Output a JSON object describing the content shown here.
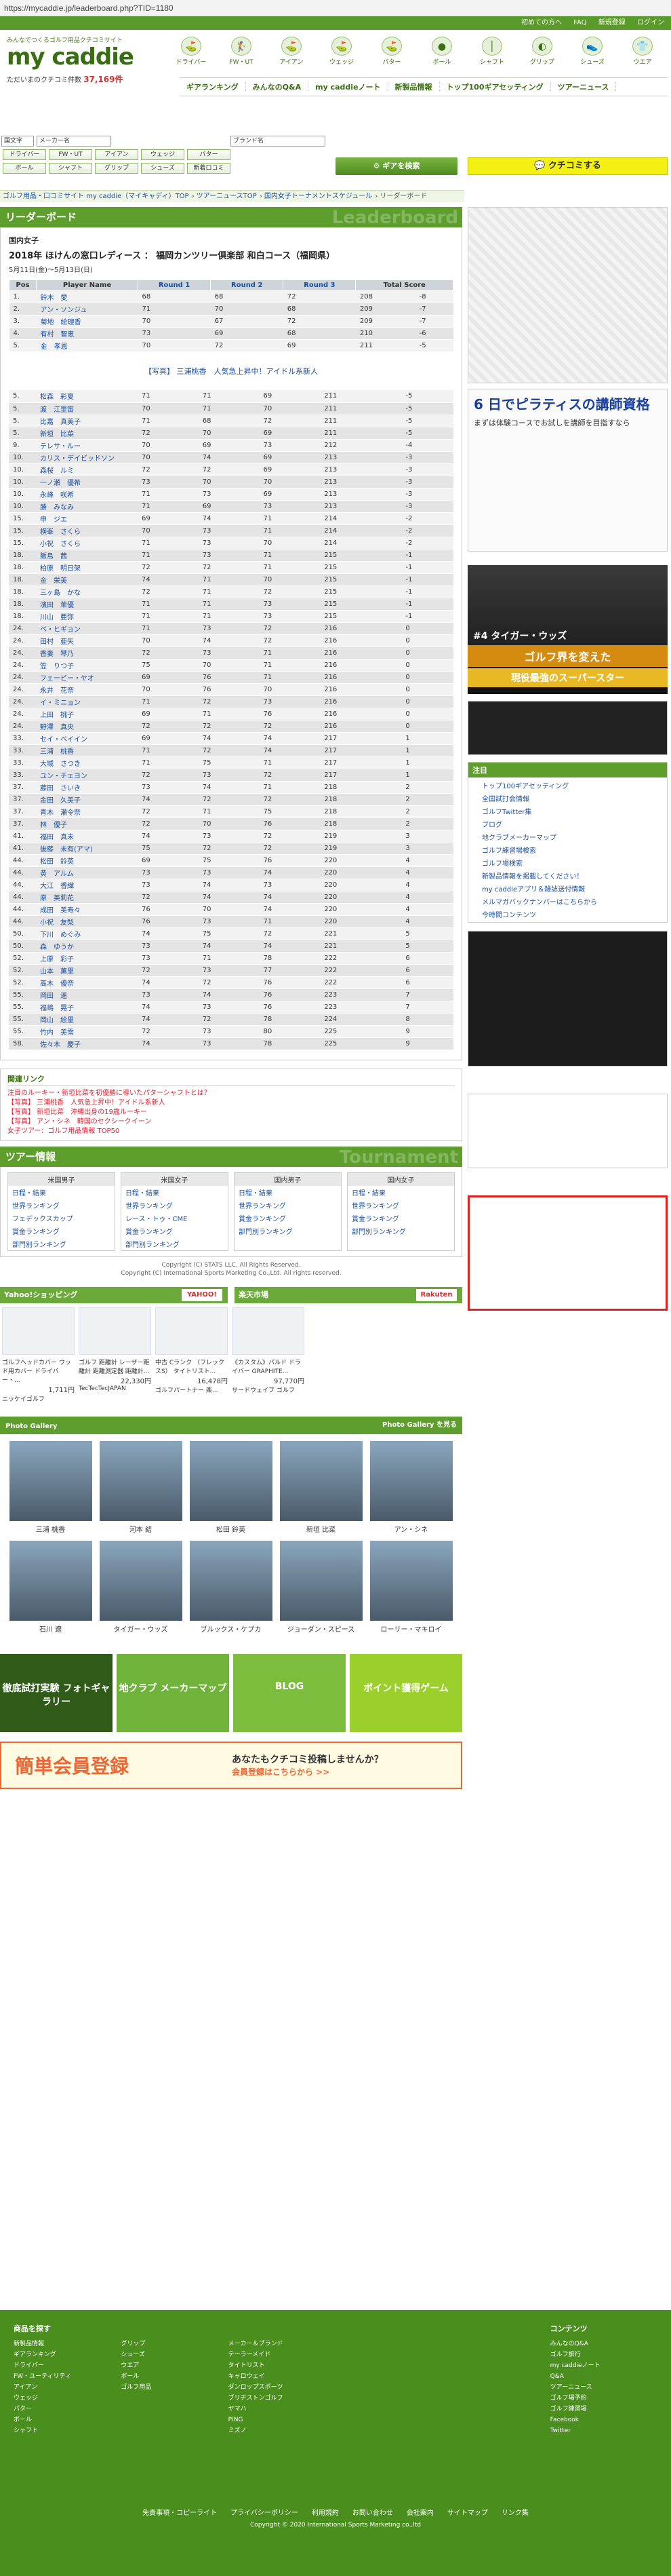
{
  "url": "https://mycaddie.jp/leaderboard.php?TID=1180",
  "topbar": [
    "初めての方へ",
    "FAQ",
    "新規登録",
    "ログイン"
  ],
  "site": {
    "tagline": "みんなでつくるゴルフ用品クチコミサイト",
    "logo": "my caddie",
    "review_label": "ただいまのクチコミ件数",
    "review_count": "37,169件"
  },
  "catnav": [
    "ドライバー",
    "FW・UT",
    "アイアン",
    "ウェッジ",
    "パター",
    "ボール",
    "シャフト",
    "グリップ",
    "シューズ",
    "ウエア"
  ],
  "subnav": [
    "ギアランキング",
    "みんなのQ&A",
    "my caddieノート",
    "新製品情報",
    "トップ100ギアセッティング",
    "ツアーニュース"
  ],
  "search": {
    "sel1": "国文字",
    "sel2": "メーカー名",
    "sel3": "ブランド名",
    "chips": [
      "ドライバー",
      "FW・UT",
      "アイアン",
      "ウェッジ",
      "パター",
      "ボール",
      "シャフト",
      "グリップ",
      "シューズ",
      "新着口コミ"
    ],
    "gear_button": "ギアを検索",
    "kuchi_button": "クチコミする"
  },
  "breadcrumb": [
    "ゴルフ用品・口コミサイト my caddie（マイキャディ）TOP",
    "ツアーニュースTOP",
    "国内女子トーナメントスケジュール",
    "リーダーボード"
  ],
  "leaderboard": {
    "bar": "リーダーボード",
    "ghost": "Leaderboard",
    "category": "国内女子",
    "title": "2018年 ほけんの窓口レディース ： 福岡カンツリー倶楽部 和白コース（福岡県）",
    "date": "5月11日(金)～5月13日(日)",
    "headers": [
      "Pos",
      "Player Name",
      "Round 1",
      "Round 2",
      "Round 3",
      "Total Score"
    ],
    "promo": "【写真】 三浦桃香　人気急上昇中！アイドル系新人",
    "top": [
      [
        "1.",
        "鈴木　愛",
        "68",
        "68",
        "72",
        "208",
        "-8"
      ],
      [
        "2.",
        "アン・ソンジュ",
        "71",
        "70",
        "68",
        "209",
        "-7"
      ],
      [
        "3.",
        "菊地　絵理香",
        "70",
        "67",
        "72",
        "209",
        "-7"
      ],
      [
        "4.",
        "有村　智恵",
        "73",
        "69",
        "68",
        "210",
        "-6"
      ],
      [
        "5.",
        "金　孝恩",
        "70",
        "72",
        "69",
        "211",
        "-5"
      ]
    ],
    "rows": [
      [
        "5.",
        "松森　彩夏",
        "71",
        "71",
        "69",
        "211",
        "-5"
      ],
      [
        "5.",
        "渡　江里笛",
        "70",
        "71",
        "70",
        "211",
        "-5"
      ],
      [
        "5.",
        "比嘉　真美子",
        "71",
        "68",
        "72",
        "211",
        "-5"
      ],
      [
        "5.",
        "新垣　比菜",
        "72",
        "70",
        "69",
        "211",
        "-5"
      ],
      [
        "9.",
        "テレサ・ルー",
        "70",
        "69",
        "73",
        "212",
        "-4"
      ],
      [
        "10.",
        "カリス・デイビッドソン",
        "70",
        "74",
        "69",
        "213",
        "-3"
      ],
      [
        "10.",
        "森桜　ルミ",
        "72",
        "72",
        "69",
        "213",
        "-3"
      ],
      [
        "10.",
        "一ノ瀬　優希",
        "73",
        "70",
        "70",
        "213",
        "-3"
      ],
      [
        "10.",
        "永峰　咲希",
        "71",
        "73",
        "69",
        "213",
        "-3"
      ],
      [
        "10.",
        "勝　みなみ",
        "71",
        "69",
        "73",
        "213",
        "-3"
      ],
      [
        "15.",
        "申　ジエ",
        "69",
        "74",
        "71",
        "214",
        "-2"
      ],
      [
        "15.",
        "横峯　さくら",
        "70",
        "73",
        "71",
        "214",
        "-2"
      ],
      [
        "15.",
        "小祝　さくら",
        "71",
        "73",
        "70",
        "214",
        "-2"
      ],
      [
        "18.",
        "飯島　茜",
        "71",
        "73",
        "71",
        "215",
        "-1"
      ],
      [
        "18.",
        "柏原　明日架",
        "72",
        "72",
        "71",
        "215",
        "-1"
      ],
      [
        "18.",
        "金　栄美",
        "74",
        "71",
        "70",
        "215",
        "-1"
      ],
      [
        "18.",
        "三ヶ島　かな",
        "72",
        "71",
        "72",
        "215",
        "-1"
      ],
      [
        "18.",
        "濱田　茉優",
        "71",
        "71",
        "73",
        "215",
        "-1"
      ],
      [
        "18.",
        "川山　亜弥",
        "71",
        "71",
        "73",
        "215",
        "-1"
      ],
      [
        "24.",
        "ペ・ヒギョン",
        "71",
        "73",
        "72",
        "216",
        "0"
      ],
      [
        "24.",
        "田村　亜矢",
        "70",
        "74",
        "72",
        "216",
        "0"
      ],
      [
        "24.",
        "香妻　琴乃",
        "72",
        "73",
        "71",
        "216",
        "0"
      ],
      [
        "24.",
        "笠　りつ子",
        "75",
        "70",
        "71",
        "216",
        "0"
      ],
      [
        "24.",
        "フェービー・ヤオ",
        "69",
        "76",
        "71",
        "216",
        "0"
      ],
      [
        "24.",
        "永井　花奈",
        "70",
        "76",
        "70",
        "216",
        "0"
      ],
      [
        "24.",
        "イ・ミニョン",
        "71",
        "72",
        "73",
        "216",
        "0"
      ],
      [
        "24.",
        "上田　桃子",
        "69",
        "71",
        "76",
        "216",
        "0"
      ],
      [
        "24.",
        "野澤　真央",
        "72",
        "72",
        "72",
        "216",
        "0"
      ],
      [
        "33.",
        "セイ・ペイイン",
        "69",
        "74",
        "74",
        "217",
        "1"
      ],
      [
        "33.",
        "三浦　桃香",
        "71",
        "72",
        "74",
        "217",
        "1"
      ],
      [
        "33.",
        "大城　さつき",
        "71",
        "75",
        "71",
        "217",
        "1"
      ],
      [
        "33.",
        "ユン・チェヨン",
        "72",
        "73",
        "72",
        "217",
        "1"
      ],
      [
        "37.",
        "藤田　さいき",
        "73",
        "74",
        "71",
        "218",
        "2"
      ],
      [
        "37.",
        "金田　久美子",
        "74",
        "72",
        "72",
        "218",
        "2"
      ],
      [
        "37.",
        "青木　瀬令奈",
        "72",
        "71",
        "75",
        "218",
        "2"
      ],
      [
        "37.",
        "林　優子",
        "72",
        "70",
        "76",
        "218",
        "2"
      ],
      [
        "41.",
        "福田　真未",
        "74",
        "73",
        "72",
        "219",
        "3"
      ],
      [
        "41.",
        "後藤　未有(アマ)",
        "75",
        "72",
        "72",
        "219",
        "3"
      ],
      [
        "44.",
        "松田　鈴英",
        "69",
        "75",
        "76",
        "220",
        "4"
      ],
      [
        "44.",
        "黄　アルム",
        "73",
        "73",
        "74",
        "220",
        "4"
      ],
      [
        "44.",
        "大江　香織",
        "73",
        "74",
        "73",
        "220",
        "4"
      ],
      [
        "44.",
        "原　英莉花",
        "72",
        "74",
        "74",
        "220",
        "4"
      ],
      [
        "44.",
        "成田　美寿々",
        "76",
        "70",
        "74",
        "220",
        "4"
      ],
      [
        "44.",
        "小祝　友梨",
        "76",
        "73",
        "71",
        "220",
        "4"
      ],
      [
        "50.",
        "下川　めぐみ",
        "74",
        "75",
        "72",
        "221",
        "5"
      ],
      [
        "50.",
        "森　ゆうか",
        "73",
        "74",
        "74",
        "221",
        "5"
      ],
      [
        "52.",
        "上原　彩子",
        "73",
        "71",
        "78",
        "222",
        "6"
      ],
      [
        "52.",
        "山本　薫里",
        "72",
        "73",
        "77",
        "222",
        "6"
      ],
      [
        "52.",
        "高木　優奈",
        "74",
        "72",
        "76",
        "222",
        "6"
      ],
      [
        "55.",
        "岡田　遥",
        "73",
        "74",
        "76",
        "223",
        "7"
      ],
      [
        "55.",
        "福嶋　晃子",
        "74",
        "73",
        "76",
        "223",
        "7"
      ],
      [
        "55.",
        "岡山　絵里",
        "74",
        "72",
        "78",
        "224",
        "8"
      ],
      [
        "55.",
        "竹内　美雪",
        "72",
        "73",
        "80",
        "225",
        "9"
      ],
      [
        "58.",
        "佐々木　慶子",
        "74",
        "73",
        "78",
        "225",
        "9"
      ]
    ]
  },
  "related": {
    "title": "関連リンク",
    "links": [
      "注目のルーキー・新垣比菜を初優勝に導いたパターシャフトとは？",
      "【写真】 三浦桃香　人気急上昇中！アイドル系新人",
      "【写真】 新垣比菜　沖縄出身の19歳ルーキー",
      "【写真】 アン・シネ　韓国のセクシークイーン",
      "女子ツアー：ゴルフ用品情報 TOP50"
    ]
  },
  "tour": {
    "bar": "ツアー情報",
    "ghost": "Tournament",
    "cols": [
      {
        "h": "米国男子",
        "items": [
          "日程・結果",
          "世界ランキング",
          "フェデックスカップ",
          "賞金ランキング",
          "部門別ランキング"
        ]
      },
      {
        "h": "米国女子",
        "items": [
          "日程・結果",
          "世界ランキング",
          "レース・トゥ・CME",
          "賞金ランキング",
          "部門別ランキング"
        ]
      },
      {
        "h": "国内男子",
        "items": [
          "日程・結果",
          "世界ランキング",
          "賞金ランキング",
          "部門別ランキング"
        ]
      },
      {
        "h": "国内女子",
        "items": [
          "日程・結果",
          "世界ランキング",
          "賞金ランキング",
          "部門別ランキング"
        ]
      }
    ],
    "copy1": "Copyright (C) STATS LLC. All Rights Reserved.",
    "copy2": "Copyright (C) International Sports Marketing Co.,Ltd. All rights reserved."
  },
  "shopping": {
    "yahoo": "Yahoo!ショッピング",
    "yahoo_tag": "YAHOO!",
    "rakuten": "楽天市場",
    "rakuten_tag": "Rakuten",
    "products": [
      {
        "name": "ゴルフヘッドカバー ウッド用カバー ドライバー・...",
        "price": "1,711円",
        "shop": "ニッケイゴルフ"
      },
      {
        "name": "ゴルフ 距離計 レーザー距離計 距離測定器 距離計...",
        "price": "22,330円",
        "shop": "TecTecTecJAPAN"
      },
      {
        "name": "中古 Cランク （フレックスS） タイトリスト...",
        "price": "16,478円",
        "shop": "ゴルフパートナー 楽..."
      },
      {
        "name": "《カスタム》パルド ドライバー GRAPHITE...",
        "price": "97,770円",
        "shop": "サードウェイブ ゴルフ"
      }
    ]
  },
  "gallery": {
    "bar": "Photo Gallery",
    "link": "Photo Gallery を見る",
    "items": [
      "三浦 桃香",
      "河本 結",
      "松田 鈴英",
      "新垣 比菜",
      "アン・シネ",
      "石川 遼",
      "タイガー・ウッズ",
      "ブルックス・ケプカ",
      "ジョーダン・スピース",
      "ローリー・マキロイ"
    ]
  },
  "banners": [
    "徹底試打実験 フォトギャラリー",
    "地クラブ メーカーマップ",
    "BLOG",
    "ポイント獲得ゲーム"
  ],
  "register": {
    "left": "簡単会員登録",
    "right": "あなたもクチコミ投稿しませんか？",
    "sub": "会員登録はこちらから >>"
  },
  "sidebar": {
    "ad_title": "6 日でピラティスの講師資格",
    "ad_sub": "まずは体験コースでお試しを講師を目指すなら",
    "golf_line1": "ゴルフ界を変えた",
    "golf_line2": "現役最強のスーパースター",
    "golf_name": "#4 タイガー・ウッズ",
    "attn_title": "注目",
    "attn": [
      "トップ100ギアセッティング",
      "全国試打会情報",
      "ゴルフTwitter集",
      "ブログ",
      "地クラブメーカーマップ",
      "ゴルフ練習場検索",
      "ゴルフ場検索",
      "新製品情報を掲載してください！",
      "my caddieアプリ＆雑誌送付情報",
      "メルマガバックナンバーはこちらから",
      "今時間コンテンツ"
    ]
  },
  "footer": {
    "products_h": "商品を探す",
    "contents_h": "コンテンツ",
    "col1": [
      "新製品情報",
      "ギアランキング",
      "ドライバー",
      "FW・ユーティリティ",
      "アイアン",
      "ウェッジ",
      "パター",
      "ボール",
      "シャフト"
    ],
    "col2": [
      "グリップ",
      "シューズ",
      "ウエア",
      "ボール",
      "ゴルフ用品"
    ],
    "col3": [
      "メーカー＆ブランド",
      "テーラーメイド",
      "タイトリスト",
      "キャロウェイ",
      "ダンロップスポーツ",
      "ブリヂストンゴルフ",
      "ヤマハ",
      "PING",
      "ミズノ"
    ],
    "contents": [
      "みんなのQ&A",
      "ゴルフ旅行",
      "my caddieノート",
      "Q&A",
      "ツアーニュース",
      "ゴルフ場予約",
      "ゴルフ練習場",
      "Facebook",
      "Twitter"
    ],
    "links": [
      "免責事項・コピーライト",
      "プライバシーポリシー",
      "利用規約",
      "お問い合わせ",
      "会社案内",
      "サイトマップ",
      "リンク集"
    ],
    "copy": "Copyright © 2020 International Sports Marketing co.,ltd"
  },
  "colors": {
    "brand": "#5d9e2c",
    "link": "#1a4fa0",
    "accent": "#f3f012"
  }
}
